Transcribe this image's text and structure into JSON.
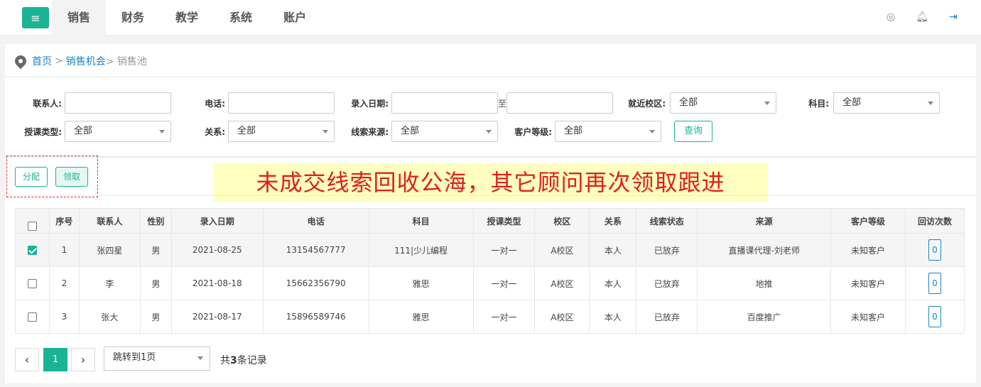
{
  "nav": {
    "menu_icon": "hamburger-icon",
    "items": [
      "销售",
      "财务",
      "教学",
      "系统",
      "账户"
    ],
    "active": "销售",
    "right_icons": [
      "support-icon",
      "bell-icon",
      "logout-icon"
    ]
  },
  "breadcrumb": {
    "home": "首页",
    "sep": ">",
    "level2": "销售机会",
    "current": "> 销售池"
  },
  "filters": {
    "contact_label": "联系人:",
    "phone_label": "电话:",
    "date_label": "录入日期:",
    "date_to": "至",
    "campus_label": "就近校区:",
    "campus_value": "全部",
    "subject_label": "科目:",
    "subject_value": "全部",
    "course_type_label": "授课类型:",
    "course_type_value": "全部",
    "relation_label": "关系:",
    "relation_value": "全部",
    "source_label": "线索来源:",
    "source_value": "全部",
    "level_label": "客户等级:",
    "level_value": "全部",
    "query_button": "查询"
  },
  "toolbar": {
    "assign_button": "分配",
    "claim_button": "领取"
  },
  "banner": "未成交线索回收公海，其它顾问再次领取跟进",
  "table": {
    "headers": [
      "",
      "序号",
      "联系人",
      "性别",
      "录入日期",
      "电话",
      "科目",
      "授课类型",
      "校区",
      "关系",
      "线索状态",
      "来源",
      "客户等级",
      "回访次数"
    ],
    "rows": [
      {
        "checked": true,
        "no": "1",
        "name": "张四星",
        "gender": "男",
        "date": "2021-08-25",
        "phone": "13154567777",
        "subject": "111|少儿编程",
        "type": "一对一",
        "campus": "A校区",
        "relation": "本人",
        "status": "已放弃",
        "source": "直播课代理-刘老师",
        "level": "未知客户",
        "visits": "0"
      },
      {
        "checked": false,
        "no": "2",
        "name": "李",
        "gender": "男",
        "date": "2021-08-18",
        "phone": "15662356790",
        "subject": "雅思",
        "type": "一对一",
        "campus": "A校区",
        "relation": "本人",
        "status": "已放弃",
        "source": "地推",
        "level": "未知客户",
        "visits": "0"
      },
      {
        "checked": false,
        "no": "3",
        "name": "张大",
        "gender": "男",
        "date": "2021-08-17",
        "phone": "15896589746",
        "subject": "雅思",
        "type": "一对一",
        "campus": "A校区",
        "relation": "本人",
        "status": "已放弃",
        "source": "百度推广",
        "level": "未知客户",
        "visits": "0"
      }
    ]
  },
  "pagination": {
    "prev": "‹",
    "current": "1",
    "next": "›",
    "jump": "跳转到1页",
    "total_prefix": "共",
    "total_count": "3",
    "total_suffix": "条记录"
  },
  "colors": {
    "primary": "#1ab394",
    "link": "#1c84c6",
    "banner_bg": "#ffffc0",
    "banner_text": "#e0201e"
  }
}
